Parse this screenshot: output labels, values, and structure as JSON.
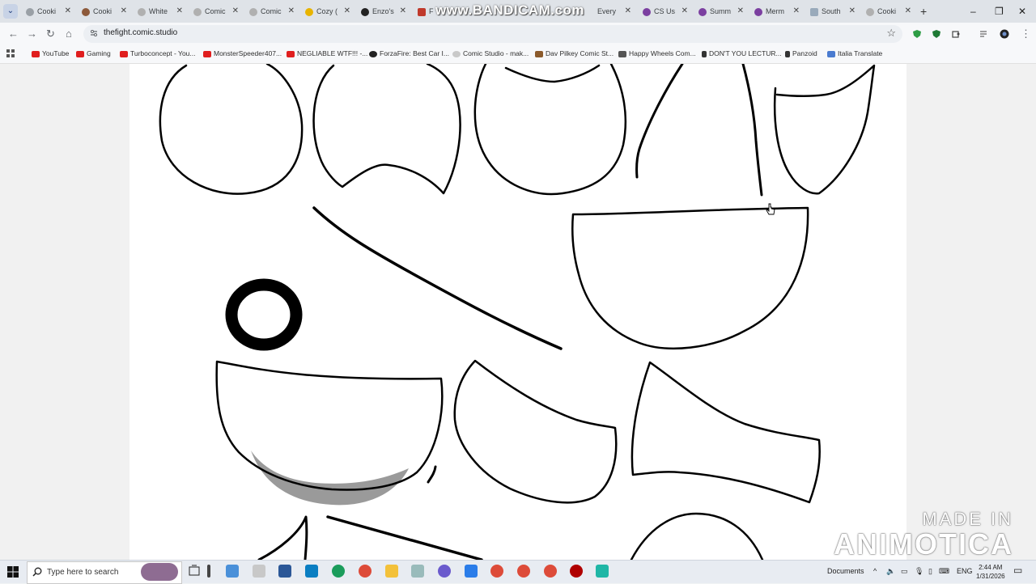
{
  "recording_overlay": "www.BANDICAM.com",
  "tabs": [
    {
      "label": "Cooki",
      "color": "#9aa0a6"
    },
    {
      "label": "Cooki",
      "color": "#8d5a3b"
    },
    {
      "label": "White",
      "color": "#b0b0b0"
    },
    {
      "label": "Comic",
      "color": "#b0b0b0"
    },
    {
      "label": "Comic",
      "color": "#b0b0b0"
    },
    {
      "label": "Cozy (",
      "color": "#e8b400"
    },
    {
      "label": "Enzo's",
      "color": "#222222"
    },
    {
      "label": "F",
      "color": "#c0392b"
    },
    {
      "label": "Every",
      "color": "#c0392b"
    },
    {
      "label": "CS Us",
      "color": "#7b3fa0"
    },
    {
      "label": "Summ",
      "color": "#7b3fa0"
    },
    {
      "label": "Merm",
      "color": "#7b3fa0"
    },
    {
      "label": "South",
      "color": "#9ab"
    },
    {
      "label": "Cooki",
      "color": "#b0b0b0"
    }
  ],
  "address": {
    "url": "thefight.comic.studio"
  },
  "bookmarks": [
    {
      "label": "YouTube",
      "color": "#e01e1e"
    },
    {
      "label": "Gaming",
      "color": "#e01e1e"
    },
    {
      "label": "Turboconcept - You...",
      "color": "#e01e1e"
    },
    {
      "label": "MonsterSpeeder407...",
      "color": "#e01e1e"
    },
    {
      "label": "NEGLIABLE WTF!!! -...",
      "color": "#e01e1e"
    },
    {
      "label": "ForzaFire: Best Car I...",
      "color": "#222222"
    },
    {
      "label": "Comic Studio - mak...",
      "color": "#c9c9c9"
    },
    {
      "label": "Dav Pilkey Comic St...",
      "color": "#8b5a2b"
    },
    {
      "label": "Happy Wheels Com...",
      "color": "#555555"
    },
    {
      "label": "DON'T YOU LECTUR...",
      "color": "#333333"
    },
    {
      "label": "Panzoid",
      "color": "#333333"
    },
    {
      "label": "Italia Translate",
      "color": "#4a7bd0"
    }
  ],
  "taskbar": {
    "search_placeholder": "Type here to search",
    "documents_label": "Documents",
    "language": "ENG",
    "time": "2:44 AM",
    "date": "1/31/2026"
  },
  "watermark": {
    "line1": "MADE IN",
    "line2": "ANIMOTICA"
  },
  "colors": {
    "tabbar": "#dfe3e8",
    "canvas": "#ffffff",
    "ink": "#000000"
  }
}
